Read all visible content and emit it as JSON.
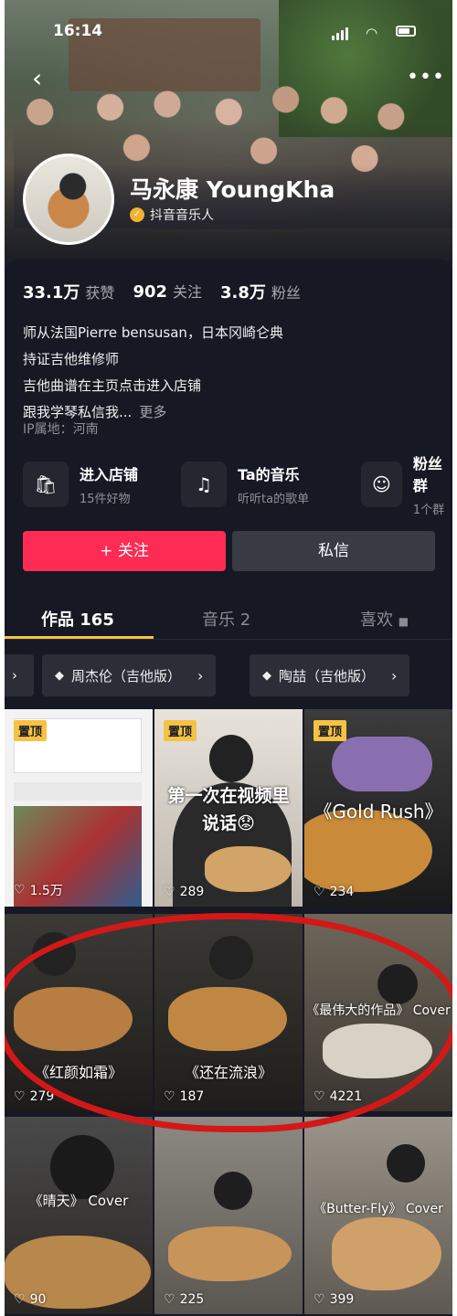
{
  "status": {
    "time": "16:14"
  },
  "profile": {
    "name": "马永康 YoungKha",
    "verified_label": "抖音音乐人",
    "stats": [
      {
        "value": "33.1万",
        "label": "获赞"
      },
      {
        "value": "902",
        "label": "关注"
      },
      {
        "value": "3.8万",
        "label": "粉丝"
      }
    ],
    "bio": [
      "师从法国Pierre bensusan，日本冈崎仑典",
      "持证吉他维修师",
      "吉他曲谱在主页点击进入店铺",
      "跟我学琴私信我..."
    ],
    "bio_more": "更多",
    "ip": "IP属地：河南"
  },
  "services": [
    {
      "icon": "shop-bag-icon",
      "title": "进入店铺",
      "sub": "15件好物"
    },
    {
      "icon": "music-note-icon",
      "title": "Ta的音乐",
      "sub": "听听ta的歌单"
    },
    {
      "icon": "fan-group-icon",
      "title": "粉丝群",
      "sub": "1个群"
    }
  ],
  "actions": {
    "follow": "+ 关注",
    "message": "私信"
  },
  "tabs": [
    {
      "label": "作品 165"
    },
    {
      "label": "音乐 2"
    },
    {
      "label": "喜欢"
    }
  ],
  "collections": [
    {
      "label": "周杰伦（吉他版）"
    },
    {
      "label": "陶喆（吉他版）"
    }
  ],
  "videos": [
    {
      "pinned": "置顶",
      "likes": "1.5万",
      "caption": ""
    },
    {
      "pinned": "置顶",
      "likes": "289",
      "caption": "第一次在视频里 说话😟"
    },
    {
      "pinned": "置顶",
      "likes": "234",
      "caption": "《Gold Rush》"
    },
    {
      "likes": "279",
      "caption": "《红颜如霜》"
    },
    {
      "likes": "187",
      "caption": "《还在流浪》"
    },
    {
      "likes": "4221",
      "caption": "《最伟大的作品》 Cover"
    },
    {
      "likes": "90",
      "caption": "《晴天》 Cover"
    },
    {
      "likes": "225",
      "caption": ""
    },
    {
      "likes": "399",
      "caption": "《Butter-Fly》 Cover"
    }
  ],
  "colors": {
    "accent": "#fe2c55",
    "pin": "#f6c243",
    "bg": "#161823",
    "highlight": "#d41818"
  }
}
